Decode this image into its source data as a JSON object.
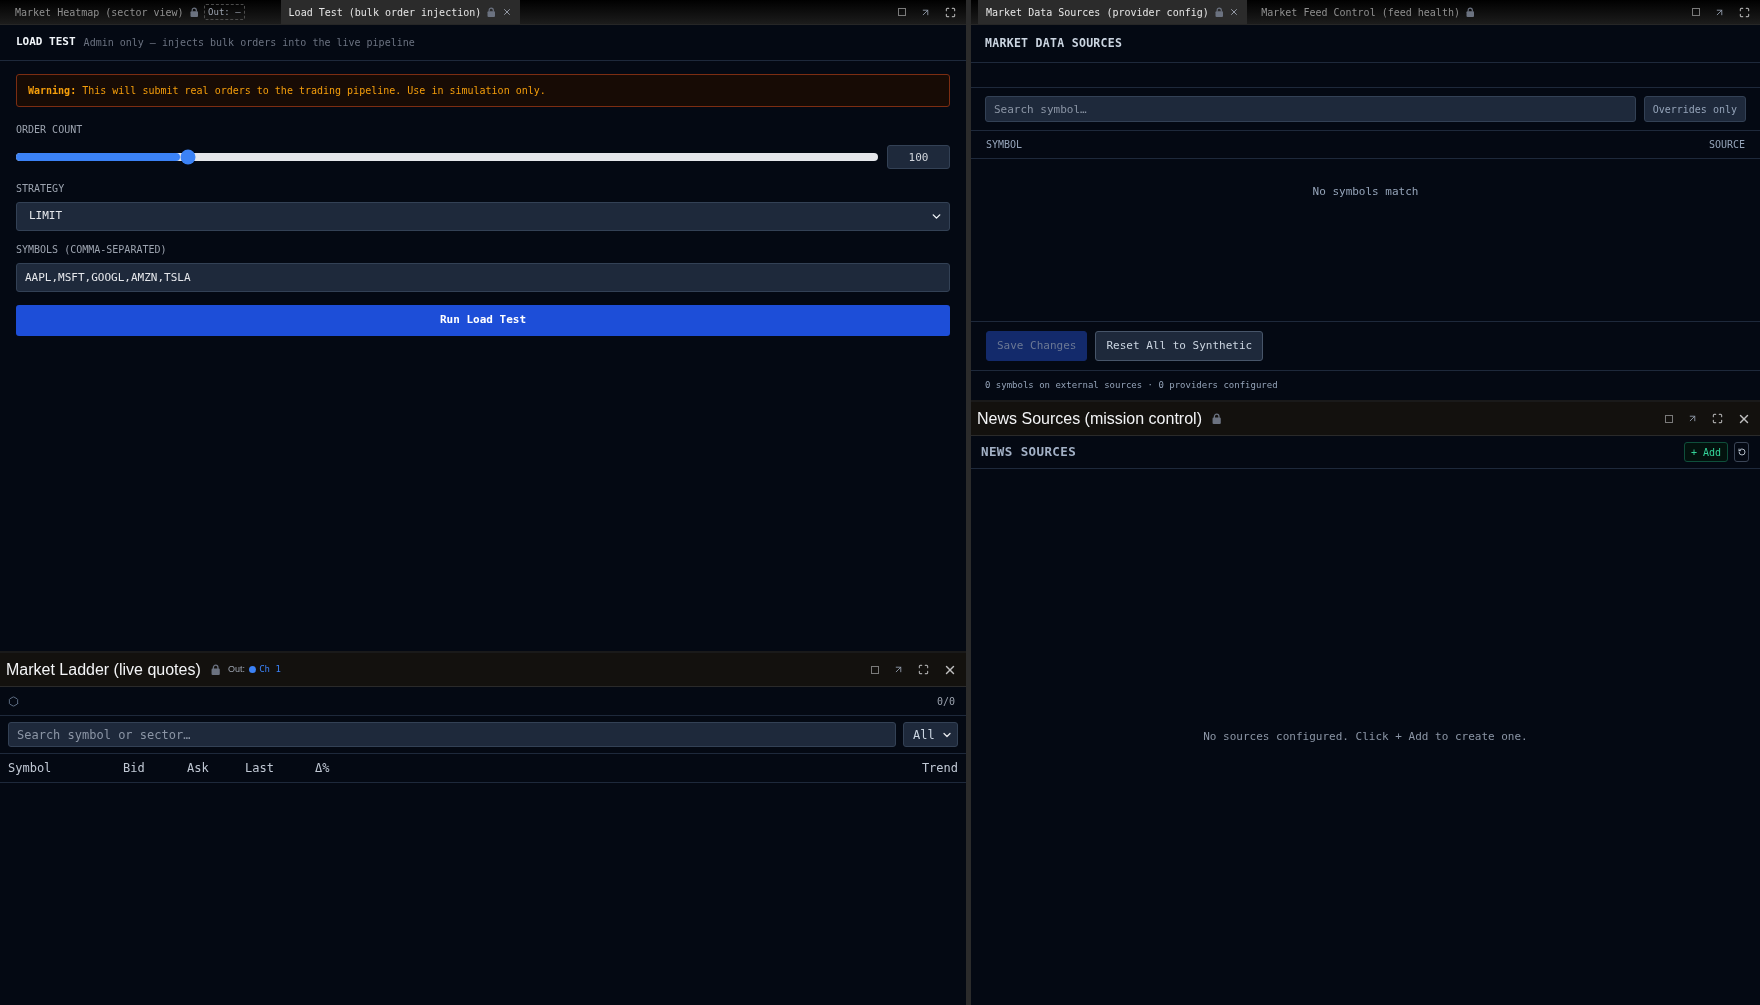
{
  "load_test_panel": {
    "tabs": [
      {
        "label": "Market Heatmap (sector view)",
        "selected": false,
        "locked": true,
        "output": "Out: –"
      },
      {
        "label": "Load Test (bulk order injection)",
        "selected": true,
        "locked": true
      }
    ],
    "header": {
      "title": "LOAD TEST",
      "subtitle": "Admin only — injects bulk orders into the live pipeline"
    },
    "warning": "**Warning:** This will submit real orders to the trading pipeline. Use in simulation only.",
    "order_count": {
      "label": "ORDER COUNT",
      "level": 0.2,
      "value": "100"
    },
    "strategy": {
      "label": "STRATEGY",
      "value": "LIMIT"
    },
    "symbols": {
      "label": "SYMBOLS (COMMA-SEPARATED)",
      "value": "AAPL,MSFT,GOOGL,AMZN,TSLA"
    },
    "run_button": "Run Load Test"
  },
  "market_ladder_panel": {
    "title": "Market Ladder (live quotes)",
    "locked": true,
    "output": {
      "label": "Out:",
      "channel": "Ch 1",
      "color": "#3b82f6"
    },
    "count": "0/0",
    "search": {
      "placeholder": "Search symbol or sector…"
    },
    "filter": {
      "value": "All"
    },
    "columns": [
      "Symbol",
      "Bid",
      "Ask",
      "Last",
      "Δ%",
      "Trend"
    ]
  },
  "market_data_sources_panel": {
    "tabs": [
      {
        "label": "Market Data Sources (provider config)",
        "selected": true,
        "locked": true
      },
      {
        "label": "Market Feed Control (feed health)",
        "selected": false,
        "locked": true
      }
    ],
    "header": "MARKET DATA SOURCES",
    "search": {
      "placeholder": "Search symbol…"
    },
    "overrides_toggle": {
      "label": "Overrides only",
      "on": false
    },
    "columns": [
      "SYMBOL",
      "SOURCE"
    ],
    "empty_message": "No symbols match",
    "buttons": [
      {
        "label": "Save Changes",
        "kind": "primary",
        "disabled": true
      },
      {
        "label": "Reset All to Synthetic",
        "kind": "secondary",
        "disabled": false
      }
    ],
    "footer": "0 symbols on external sources · 0 providers configured"
  },
  "news_sources_panel": {
    "title": "News Sources (mission control)",
    "locked": true,
    "header": "NEWS SOURCES",
    "add_button": "+ Add",
    "empty_message": "No sources configured. Click + Add to create one."
  }
}
